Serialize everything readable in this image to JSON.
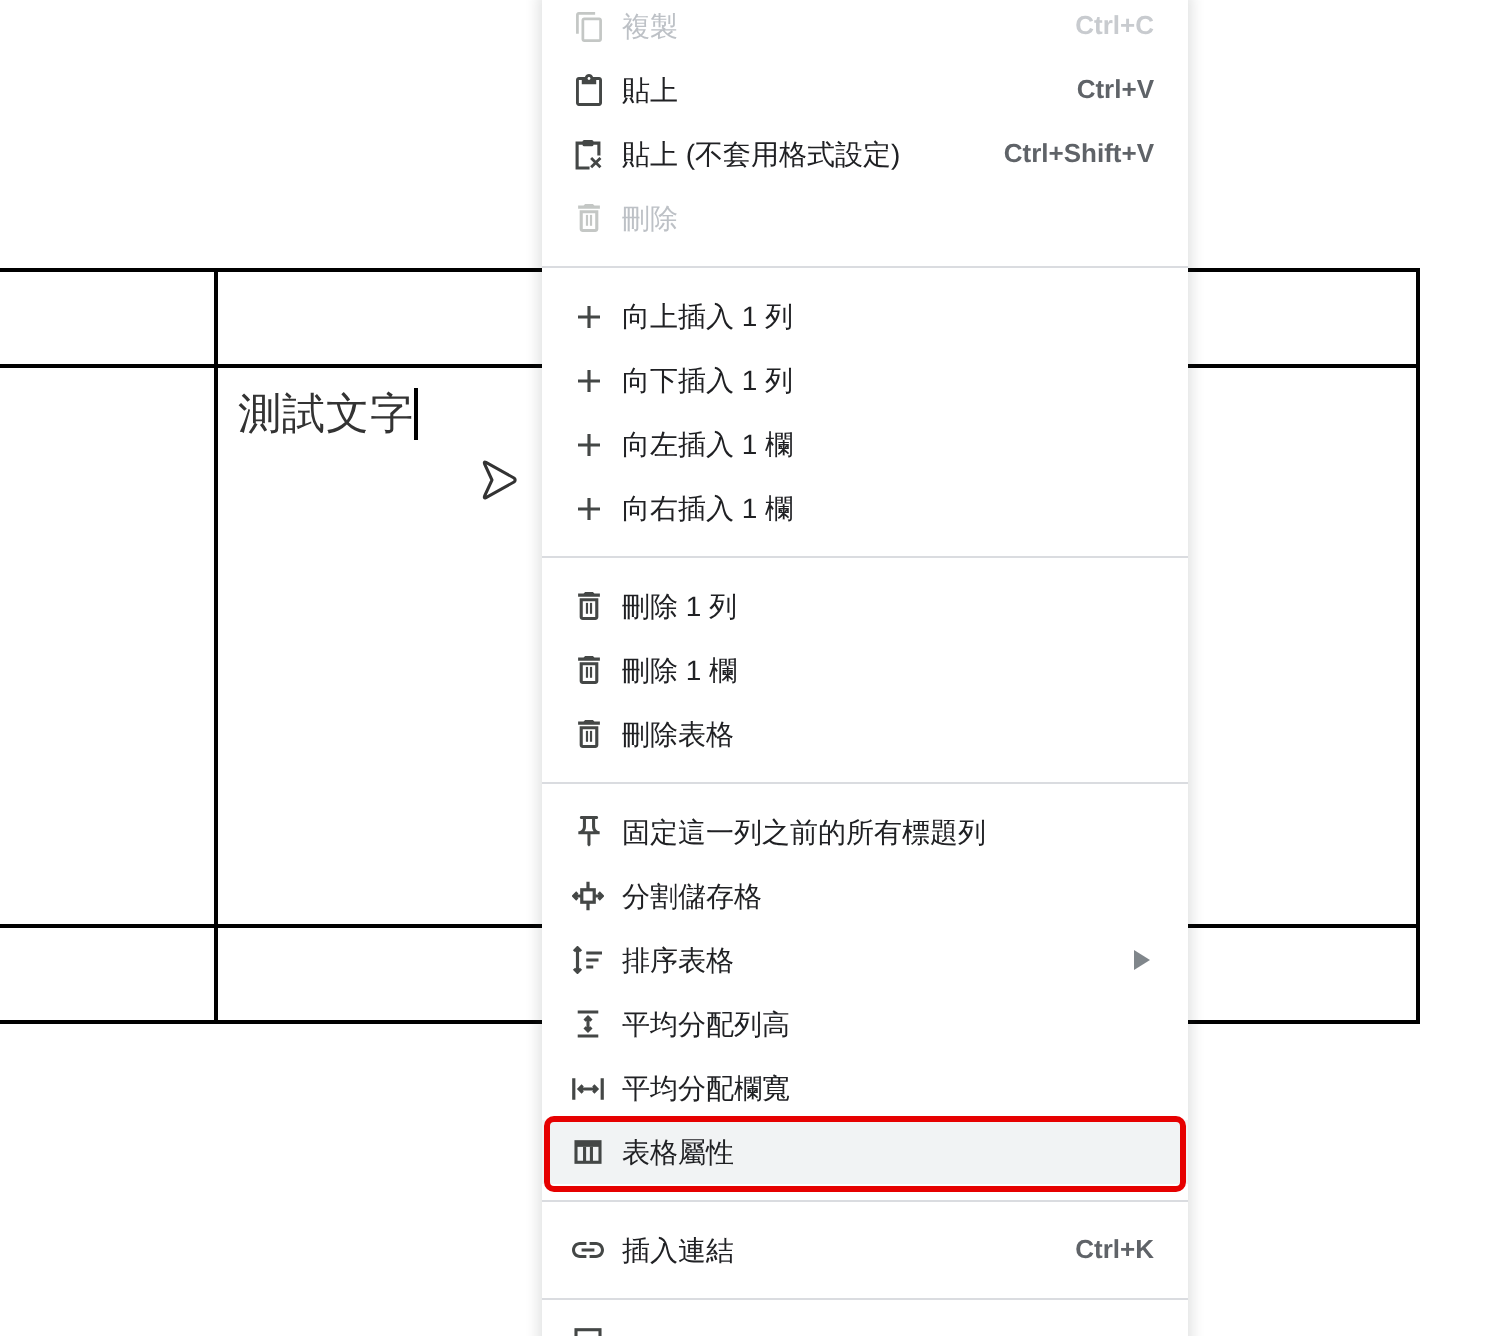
{
  "table": {
    "rows": [
      {
        "cells": [
          {
            "caret": false
          },
          {
            "caret": false
          }
        ]
      },
      {
        "cells": [
          {
            "caret": false
          },
          {
            "text": "測試文字",
            "caret": true
          }
        ]
      },
      {
        "cells": [
          {
            "caret": false
          },
          {
            "caret": false
          }
        ]
      }
    ]
  },
  "context_menu": {
    "sections": [
      {
        "items": [
          {
            "label": "複製",
            "shortcut": "Ctrl+C",
            "disabled": true,
            "highlighted": false,
            "outlined": false,
            "submenu": false
          },
          {
            "label": "貼上",
            "shortcut": "Ctrl+V",
            "disabled": false,
            "highlighted": false,
            "outlined": false,
            "submenu": false
          },
          {
            "label": "貼上 (不套用格式設定)",
            "shortcut": "Ctrl+Shift+V",
            "disabled": false,
            "highlighted": false,
            "outlined": false,
            "submenu": false
          },
          {
            "label": "刪除",
            "disabled": true,
            "highlighted": false,
            "outlined": false,
            "submenu": false
          }
        ]
      },
      {
        "items": [
          {
            "label": "向上插入 1 列",
            "disabled": false,
            "highlighted": false,
            "outlined": false,
            "submenu": false
          },
          {
            "label": "向下插入 1 列",
            "disabled": false,
            "highlighted": false,
            "outlined": false,
            "submenu": false
          },
          {
            "label": "向左插入 1 欄",
            "disabled": false,
            "highlighted": false,
            "outlined": false,
            "submenu": false
          },
          {
            "label": "向右插入 1 欄",
            "disabled": false,
            "highlighted": false,
            "outlined": false,
            "submenu": false
          }
        ]
      },
      {
        "items": [
          {
            "label": "刪除 1 列",
            "disabled": false,
            "highlighted": false,
            "outlined": false,
            "submenu": false
          },
          {
            "label": "刪除 1 欄",
            "disabled": false,
            "highlighted": false,
            "outlined": false,
            "submenu": false
          },
          {
            "label": "刪除表格",
            "disabled": false,
            "highlighted": false,
            "outlined": false,
            "submenu": false
          }
        ]
      },
      {
        "items": [
          {
            "label": "固定這一列之前的所有標題列",
            "disabled": false,
            "highlighted": false,
            "outlined": false,
            "submenu": false
          },
          {
            "label": "分割儲存格",
            "disabled": false,
            "highlighted": false,
            "outlined": false,
            "submenu": false
          },
          {
            "label": "排序表格",
            "disabled": false,
            "highlighted": false,
            "outlined": false,
            "submenu": true
          },
          {
            "label": "平均分配列高",
            "disabled": false,
            "highlighted": false,
            "outlined": false,
            "submenu": false
          },
          {
            "label": "平均分配欄寬",
            "disabled": false,
            "highlighted": false,
            "outlined": false,
            "submenu": false
          },
          {
            "label": "表格屬性",
            "disabled": false,
            "highlighted": true,
            "outlined": true,
            "submenu": false
          }
        ]
      },
      {
        "items": [
          {
            "label": "插入連結",
            "shortcut": "Ctrl+K",
            "disabled": false,
            "highlighted": false,
            "outlined": false,
            "submenu": false
          }
        ]
      }
    ]
  }
}
